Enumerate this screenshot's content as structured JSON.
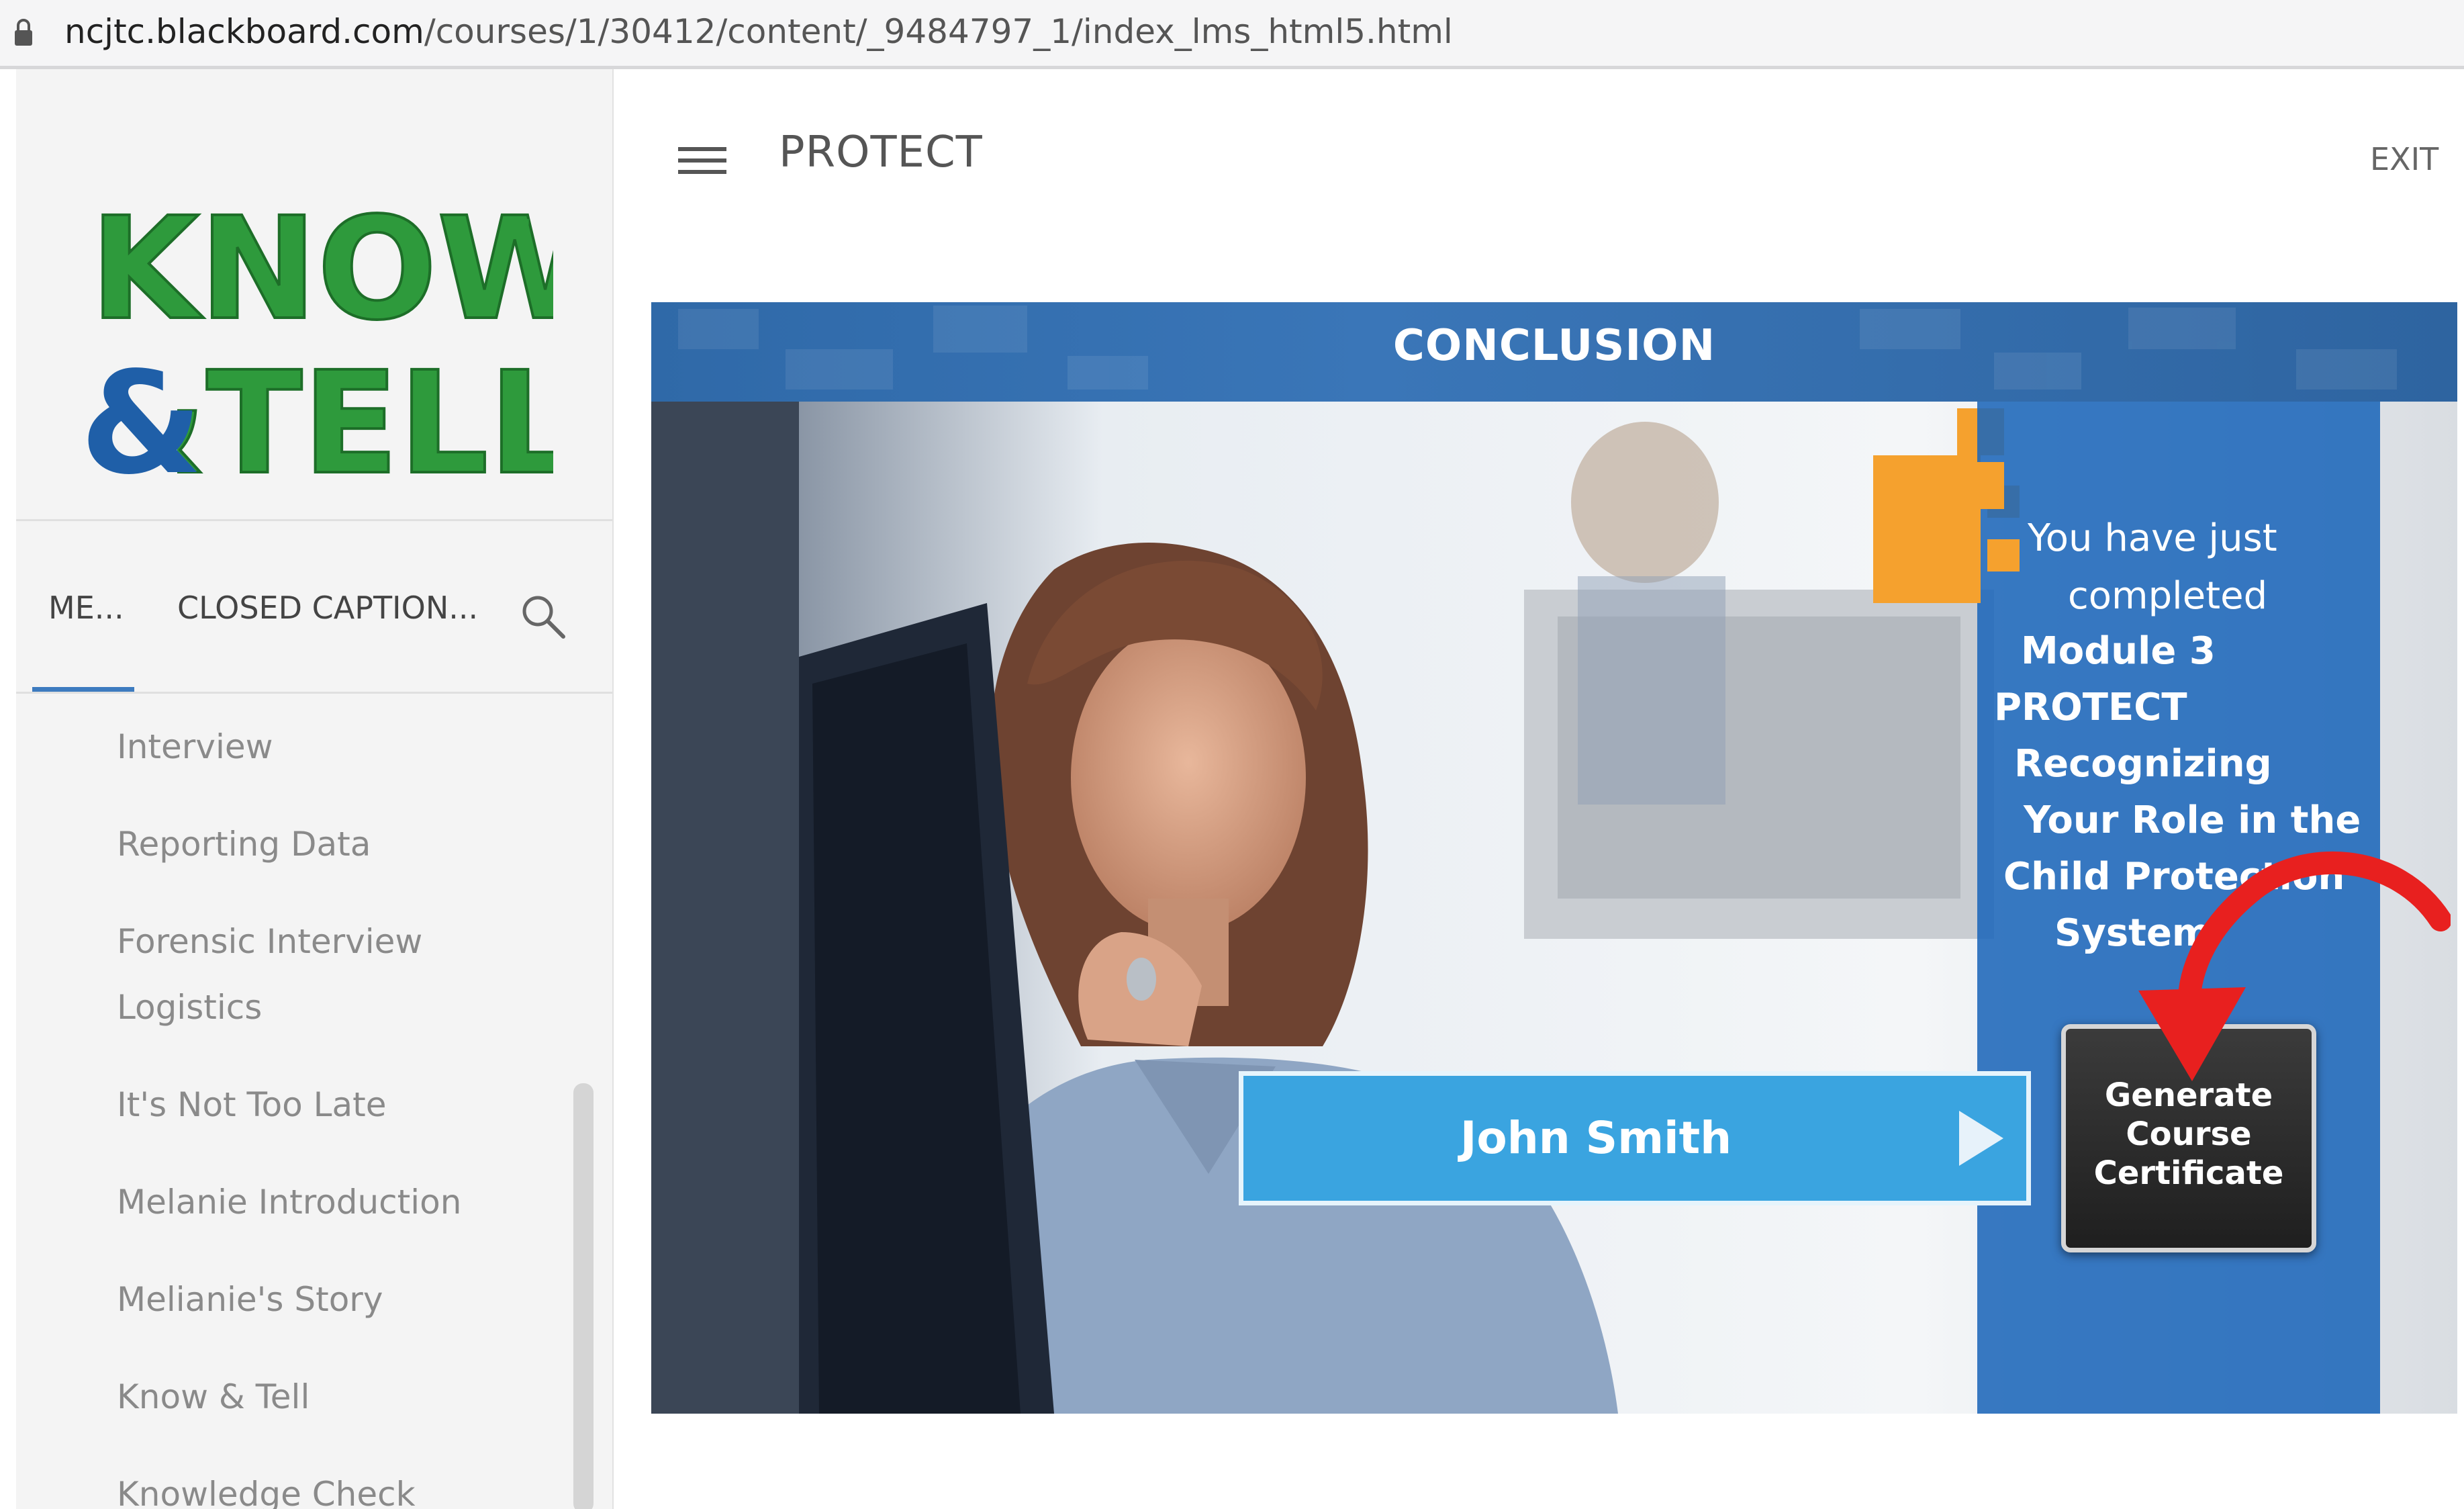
{
  "address_bar": {
    "host": "ncjtc.blackboard.com",
    "path": "/courses/1/30412/content/_9484797_1/index_lms_html5.html"
  },
  "sidebar": {
    "logo": {
      "line1": "KNOW",
      "line2": "&TELL",
      "trademark": "™"
    },
    "tabs": [
      {
        "label": "ME...",
        "active": true
      },
      {
        "label": "CLOSED CAPTION...",
        "active": false
      }
    ],
    "items": [
      {
        "label": "Interview"
      },
      {
        "label": "Reporting Data"
      },
      {
        "label": "Forensic Interview"
      },
      {
        "label": "Logistics"
      },
      {
        "label": "It's Not Too Late"
      },
      {
        "label": "Melanie Introduction"
      },
      {
        "label": "Melianie's Story"
      },
      {
        "label": "Know & Tell"
      },
      {
        "label": "Knowledge Check"
      }
    ]
  },
  "header": {
    "title": "PROTECT",
    "exit_label": "EXIT"
  },
  "slide": {
    "title": "CONCLUSION",
    "completion_lines": [
      {
        "text": "You have just",
        "bold": false
      },
      {
        "text": "completed",
        "bold": false
      },
      {
        "text": "Module 3",
        "bold": true
      },
      {
        "text": "PROTECT",
        "bold": true
      },
      {
        "text": "Recognizing",
        "bold": true
      },
      {
        "text": "Your Role in the",
        "bold": true
      },
      {
        "text": "Child Protection",
        "bold": true
      },
      {
        "text": "System",
        "bold": true
      }
    ],
    "name_value": "John Smith",
    "certificate_button": {
      "line1": "Generate",
      "line2": "Course",
      "line3": "Certificate"
    }
  },
  "colors": {
    "accent_blue": "#3aa4e0",
    "panel_blue": "#1c66b9",
    "logo_green": "#2e9a3c",
    "logo_blue": "#1f5fa8",
    "accent_orange": "#f5a12e",
    "annotation_red": "#e8201f"
  },
  "icons": [
    "lock-icon",
    "search-icon",
    "hamburger-icon",
    "play-icon",
    "arrow-annotation-icon"
  ]
}
